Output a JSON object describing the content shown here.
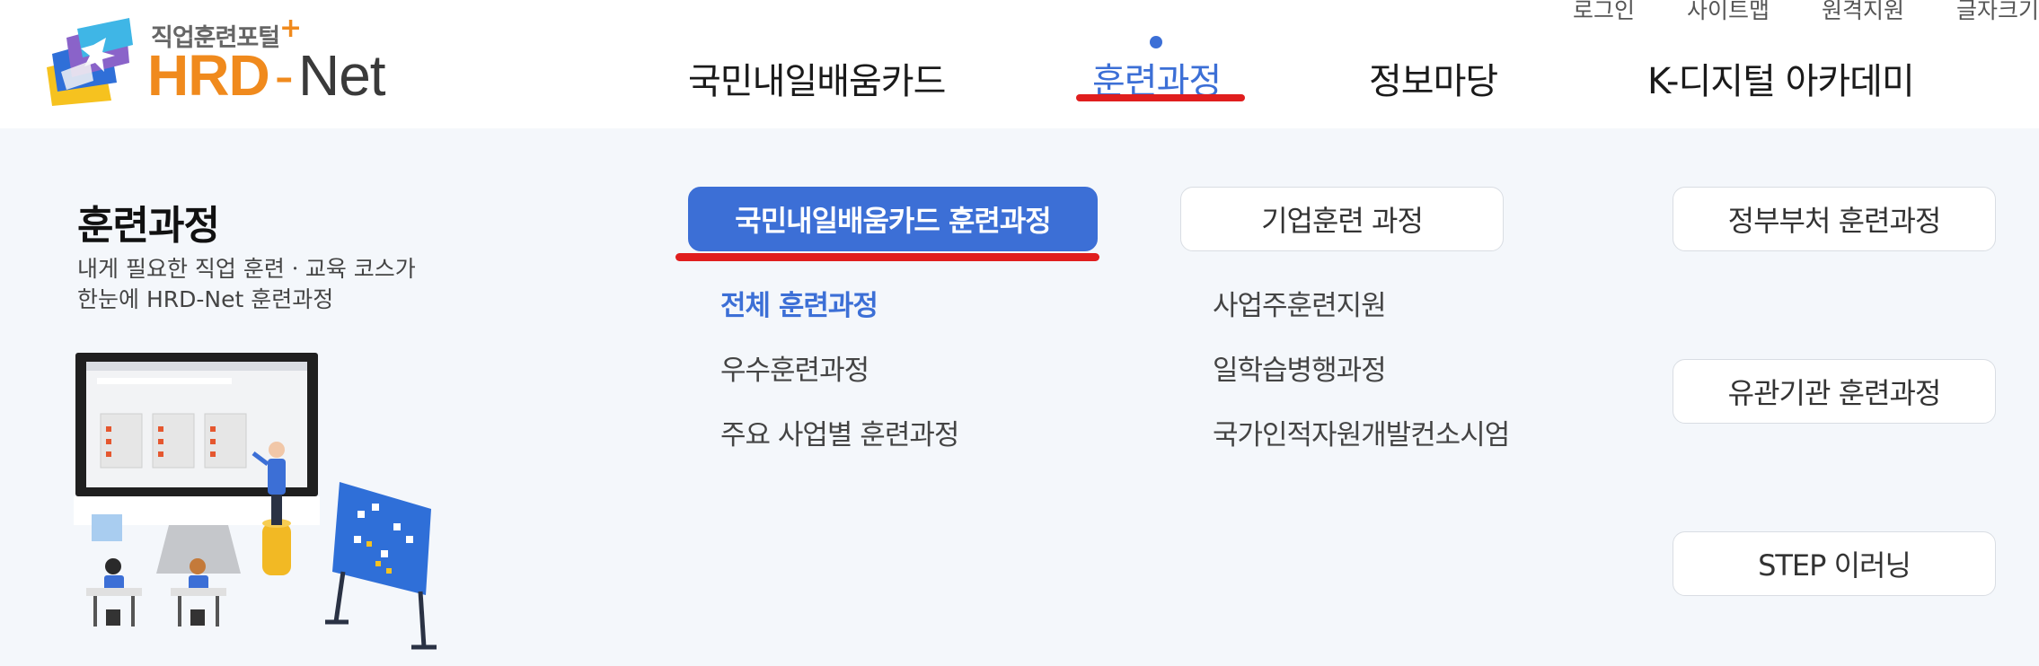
{
  "header": {
    "logo": {
      "subtitle": "직업훈련포털",
      "plus": "+",
      "hrd": "HRD",
      "dash": "-",
      "net": "Net"
    },
    "util_links": [
      "로그인",
      "사이트맵",
      "원격지원",
      "글자크기"
    ],
    "gnb": [
      {
        "label": "국민내일배움카드",
        "active": false
      },
      {
        "label": "훈련과정",
        "active": true
      },
      {
        "label": "정보마당",
        "active": false
      },
      {
        "label": "K-디지털 아카데미",
        "active": false
      }
    ]
  },
  "panel": {
    "title": "훈련과정",
    "description": [
      "내게 필요한 직업 훈련ㆍ교육 코스가",
      "한눈에 HRD-Net 훈련과정"
    ],
    "categories": [
      {
        "label": "국민내일배움카드 훈련과정",
        "active": true
      },
      {
        "label": "기업훈련 과정",
        "active": false
      },
      {
        "label": "정부부처 훈련과정",
        "active": false
      },
      {
        "label": "유관기관 훈련과정",
        "active": false
      },
      {
        "label": "STEP 이러닝",
        "active": false
      }
    ],
    "card_links": [
      {
        "label": "전체 훈련과정",
        "active": true
      },
      {
        "label": "우수훈련과정",
        "active": false
      },
      {
        "label": "주요 사업별 훈련과정",
        "active": false
      }
    ],
    "company_links": [
      {
        "label": "사업주훈련지원",
        "active": false
      },
      {
        "label": "일학습병행과정",
        "active": false
      },
      {
        "label": "국가인적자원개발컨소시엄",
        "active": false
      }
    ]
  },
  "colors": {
    "accent": "#3c6fd6",
    "highlight": "#e01e1e",
    "brand_orange": "#f08a1d",
    "panel_bg": "#f4f7fb"
  }
}
